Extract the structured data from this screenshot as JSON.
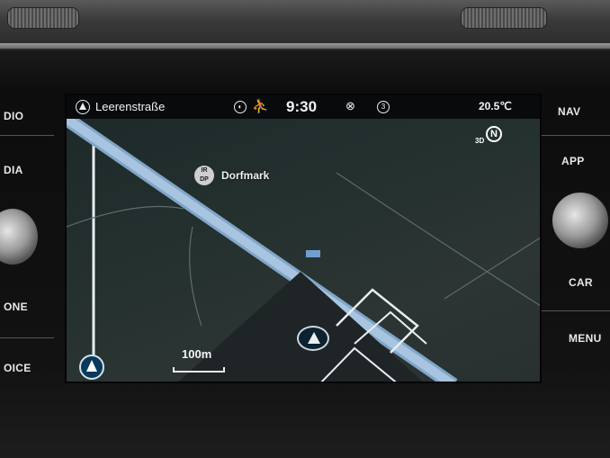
{
  "status_bar": {
    "street": "Leerenstraße",
    "time": "9:30",
    "temperature": "20.5℃",
    "circle_number": "3",
    "icons": [
      "nav-arrow-icon",
      "compass-icon",
      "driver-icon",
      "mute-icon",
      "circle-3-icon"
    ]
  },
  "map": {
    "view_mode": "3D",
    "north_letter": "N",
    "poi": {
      "label": "Dorfmark",
      "icon_text": "IR\nDP"
    },
    "scale": "100m",
    "colors": {
      "route": "#a8c4e0",
      "road_white": "#e8eef2",
      "map_bg": "#24312f",
      "accent": "#0a3a5a"
    }
  },
  "hard_buttons": {
    "left": [
      "DIO",
      "DIA",
      "ONE",
      "OICE"
    ],
    "right": [
      "NAV",
      "APP",
      "CAR",
      "MENU"
    ]
  }
}
